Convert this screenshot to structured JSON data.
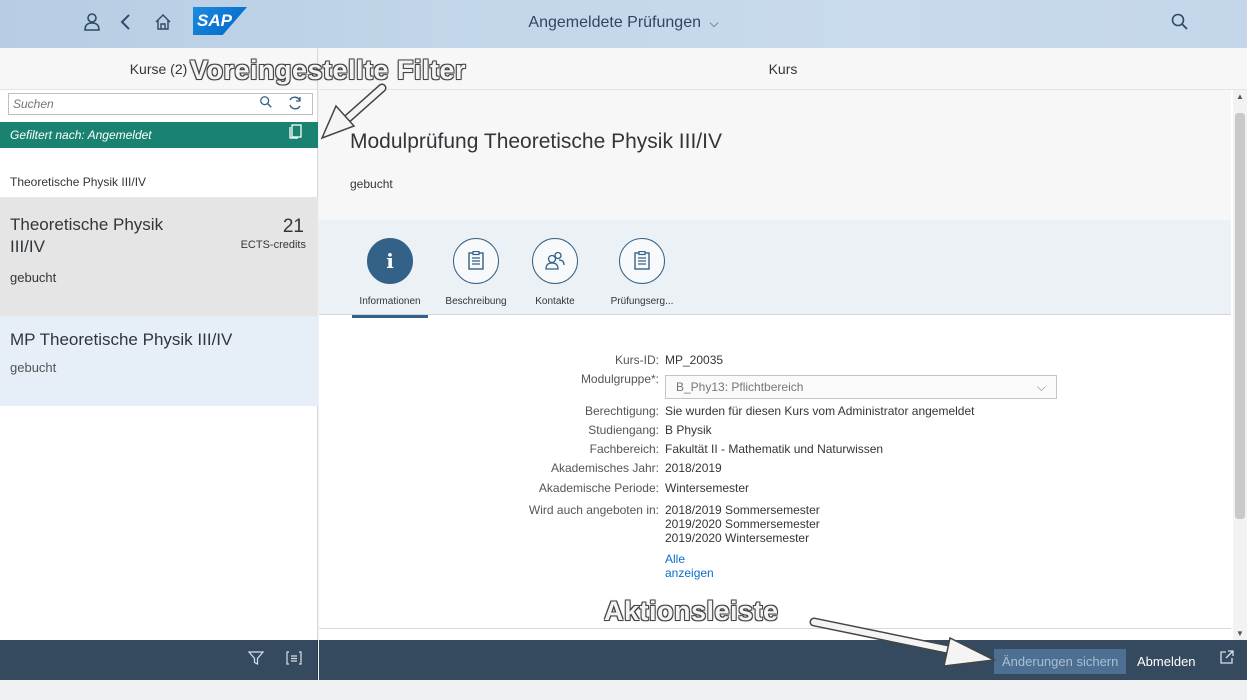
{
  "shell": {
    "title": "Angemeldete Prüfungen",
    "title_chevron": "⌵",
    "logo_text": "SAP"
  },
  "master": {
    "header": "Kurse (2)",
    "search_placeholder": "Suchen",
    "filter_text": "Gefiltert nach: Angemeldet",
    "group_header": "Theoretische Physik III/IV",
    "items": [
      {
        "title": "Theoretische Physik III/IV",
        "number": "21",
        "unit": "ECTS-credits",
        "status": "gebucht"
      },
      {
        "title": "MP Theoretische Physik III/IV",
        "status": "gebucht"
      }
    ]
  },
  "detail": {
    "header": "Kurs",
    "object_title": "Modulprüfung Theoretische Physik III/IV",
    "object_status": "gebucht",
    "tabs": [
      {
        "label": "Informationen",
        "icon": "info-icon",
        "glyph": "i"
      },
      {
        "label": "Beschreibung",
        "icon": "document-icon",
        "glyph": "🗎"
      },
      {
        "label": "Kontakte",
        "icon": "contacts-icon",
        "glyph": "👥"
      },
      {
        "label": "Prüfungserg...",
        "icon": "clipboard-icon",
        "glyph": "🗎"
      }
    ],
    "fields": {
      "kurs_id_label": "Kurs-ID:",
      "kurs_id": "MP_20035",
      "modulgruppe_label": "Modulgruppe*:",
      "modulgruppe": "B_Phy13: Pflichtbereich",
      "berechtigung_label": "Berechtigung:",
      "berechtigung": "Sie wurden für diesen Kurs vom Administrator angemeldet",
      "studiengang_label": "Studiengang:",
      "studiengang": "B Physik",
      "fachbereich_label": "Fachbereich:",
      "fachbereich": "Fakultät II - Mathematik und Naturwissen",
      "akad_jahr_label": "Akademisches Jahr:",
      "akad_jahr": "2018/2019",
      "akad_periode_label": "Akademische Periode:",
      "akad_periode": "Wintersemester",
      "angeboten_label": "Wird auch angeboten in:",
      "angeboten": [
        "2018/2019 Sommersemester",
        "2019/2020 Sommersemester",
        "2019/2020 Wintersemester"
      ],
      "alle_link_1": "Alle",
      "alle_link_2": "anzeigen"
    }
  },
  "footer": {
    "save_label": "Änderungen sichern",
    "logout_label": "Abmelden"
  },
  "annotations": {
    "filter_label": "Voreingestellte Filter",
    "actionbar_label": "Aktionsleiste"
  }
}
